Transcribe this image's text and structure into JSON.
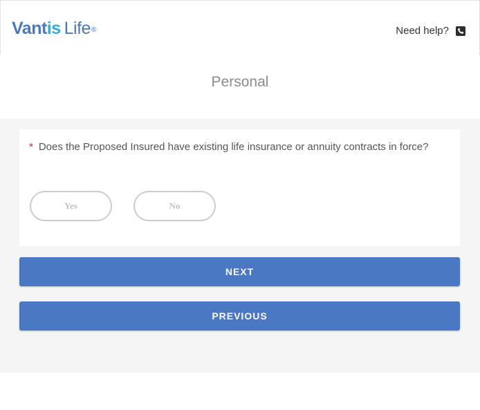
{
  "header": {
    "logo": {
      "brand_part1": "Vant",
      "brand_part2": "is",
      "brand_part3": "Life",
      "registered": "®"
    },
    "help_text": "Need help?",
    "phone_icon": "phone-icon"
  },
  "section": {
    "title": "Personal"
  },
  "question": {
    "required_marker": "*",
    "text": "Does the Proposed Insured have existing life insurance or annuity contracts in force?",
    "options": [
      "Yes",
      "No"
    ]
  },
  "buttons": {
    "next": "NEXT",
    "previous": "PREVIOUS"
  },
  "colors": {
    "brand_blue": "#4a78c2",
    "brand_light_blue": "#35a9d9",
    "required_red": "#e02020",
    "background_gray": "#f5f5f5"
  }
}
